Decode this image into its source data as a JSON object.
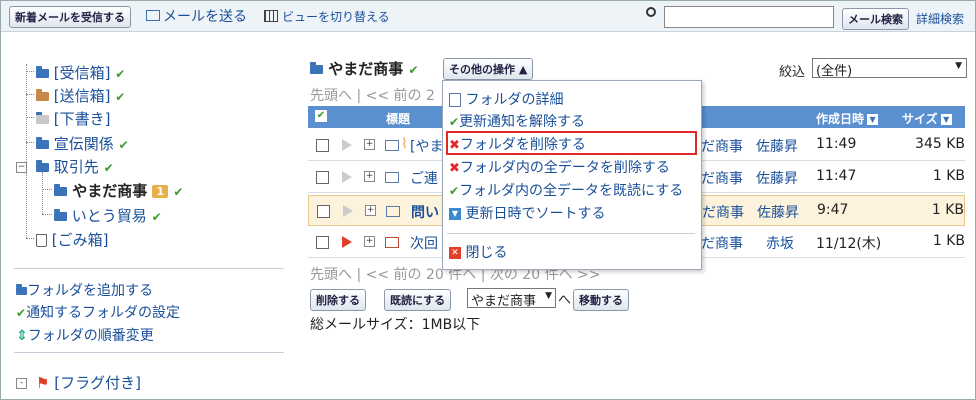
{
  "toolbar": {
    "receive_label": "新着メールを受信する",
    "send_label": "メールを送る",
    "view_label": "ビューを切り替える",
    "search_value": "",
    "search_button": "メール検索",
    "advanced_search": "詳細検索"
  },
  "sidebar": {
    "folders": [
      {
        "label": "[受信箱]"
      },
      {
        "label": "[送信箱]"
      },
      {
        "label": "[下書き]"
      },
      {
        "label": "宣伝関係"
      },
      {
        "label": "取引先"
      },
      {
        "label": "やまだ商事",
        "badge": "1"
      },
      {
        "label": "いとう貿易"
      },
      {
        "label": "[ごみ箱]"
      }
    ],
    "actions": {
      "add_folder": "フォルダを追加する",
      "notify_settings": "通知するフォルダの設定",
      "reorder": "フォルダの順番変更"
    },
    "flagged": "[フラグ付き]"
  },
  "main": {
    "folder_title": "やまだ商事",
    "other_ops": "その他の操作",
    "filter_label": "絞込",
    "filter_value": "(全件)",
    "pager_top": "先頭へ | << 前の 2",
    "pager_bottom": "先頭へ | << 前の 20 件へ | 次の 20 件へ >>",
    "columns": {
      "subject": "標題",
      "created": "作成日時",
      "size": "サイズ"
    },
    "rows": [
      {
        "subject": "[やま",
        "folder": "だ商事",
        "sender": "佐藤昇",
        "date": "11:49",
        "size": "345 KB"
      },
      {
        "subject": "ご連",
        "folder": "だ商事",
        "sender": "佐藤昇",
        "date": "11:47",
        "size": "1 KB"
      },
      {
        "subject": "問い",
        "folder": "だ商事",
        "sender": "佐藤昇",
        "date": "9:47",
        "size": "1 KB"
      },
      {
        "subject": "次回",
        "folder": "だ商事",
        "sender": "赤坂",
        "date": "11/12(木)",
        "size": "1 KB"
      }
    ],
    "delete_button": "削除する",
    "mark_read_button": "既読にする",
    "move_target": "やまだ商事",
    "move_particle": "へ",
    "move_button": "移動する",
    "total_size": "総メールサイズ：1MB以下"
  },
  "menu": {
    "items": [
      "フォルダの詳細",
      "更新通知を解除する",
      "フォルダを削除する",
      "フォルダ内の全データを削除する",
      "フォルダ内の全データを既読にする",
      "更新日時でソートする"
    ],
    "close": "閉じる"
  },
  "colors": {
    "header_blue": "#5a8fd0",
    "highlight_red": "#e02a2a",
    "link_blue": "#1a4f9a"
  }
}
